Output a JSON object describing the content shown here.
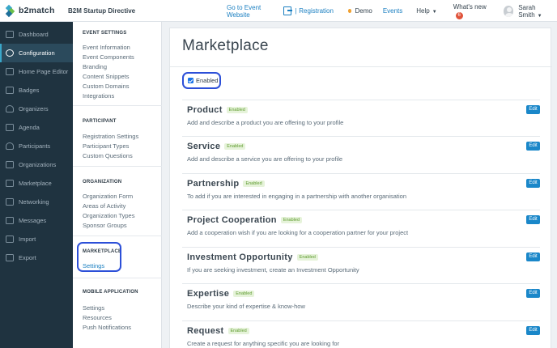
{
  "header": {
    "brand": "b2match",
    "event_title": "B2M Startup Directive",
    "go_to_event": "Go to Event Website",
    "registration": "Registration",
    "separator": "|",
    "demo": "Demo",
    "events": "Events",
    "help": "Help",
    "whats_new": "What's new",
    "whats_new_count": "6",
    "user_name": "Sarah Smith"
  },
  "sidebar": {
    "items": [
      {
        "label": "Dashboard",
        "icon": "dashboard-icon"
      },
      {
        "label": "Configuration",
        "icon": "gear-icon",
        "active": true
      },
      {
        "label": "Home Page Editor",
        "icon": "document-icon"
      },
      {
        "label": "Badges",
        "icon": "badge-icon"
      },
      {
        "label": "Organizers",
        "icon": "users-icon"
      },
      {
        "label": "Agenda",
        "icon": "calendar-icon"
      },
      {
        "label": "Participants",
        "icon": "user-icon"
      },
      {
        "label": "Organizations",
        "icon": "building-icon"
      },
      {
        "label": "Marketplace",
        "icon": "list-icon"
      },
      {
        "label": "Networking",
        "icon": "handshake-icon"
      },
      {
        "label": "Messages",
        "icon": "envelope-icon"
      },
      {
        "label": "Import",
        "icon": "import-icon"
      },
      {
        "label": "Export",
        "icon": "export-icon"
      }
    ]
  },
  "settings": {
    "event_settings": {
      "title": "EVENT SETTINGS",
      "links": [
        "Event Information",
        "Event Components",
        "Branding",
        "Content Snippets",
        "Custom Domains",
        "Integrations"
      ]
    },
    "participant": {
      "title": "PARTICIPANT",
      "links": [
        "Registration Settings",
        "Participant Types",
        "Custom Questions"
      ]
    },
    "organization": {
      "title": "ORGANIZATION",
      "links": [
        "Organization Form",
        "Areas of Activity",
        "Organization Types",
        "Sponsor Groups"
      ]
    },
    "marketplace": {
      "title": "MARKETPLACE",
      "links": [
        "Settings"
      ]
    },
    "mobile": {
      "title": "MOBILE APPLICATION",
      "links": [
        "Settings",
        "Resources",
        "Push Notifications"
      ]
    }
  },
  "main": {
    "title": "Marketplace",
    "enabled_label": "Enabled",
    "edit_label": "Edit",
    "badge_label": "Enabled",
    "items": [
      {
        "name": "Product",
        "desc": "Add and describe a product you are offering to your profile"
      },
      {
        "name": "Service",
        "desc": "Add and describe a service you are offering to your profile"
      },
      {
        "name": "Partnership",
        "desc": "To add if you are interested in engaging in a partnership with another organisation"
      },
      {
        "name": "Project Cooperation",
        "desc": "Add a cooperation wish if you are looking for a cooperation partner for your project"
      },
      {
        "name": "Investment Opportunity",
        "desc": "If you are seeking investment, create an Investment Opportunity"
      },
      {
        "name": "Expertise",
        "desc": "Describe your kind of expertise & know-how"
      },
      {
        "name": "Request",
        "desc": "Create a request for anything specific you are looking for"
      }
    ]
  },
  "colors": {
    "sidebar_bg": "#1f3340",
    "accent": "#1a7fc1",
    "highlight": "#2c4fd8",
    "badge_green": "#5e9b2e"
  }
}
